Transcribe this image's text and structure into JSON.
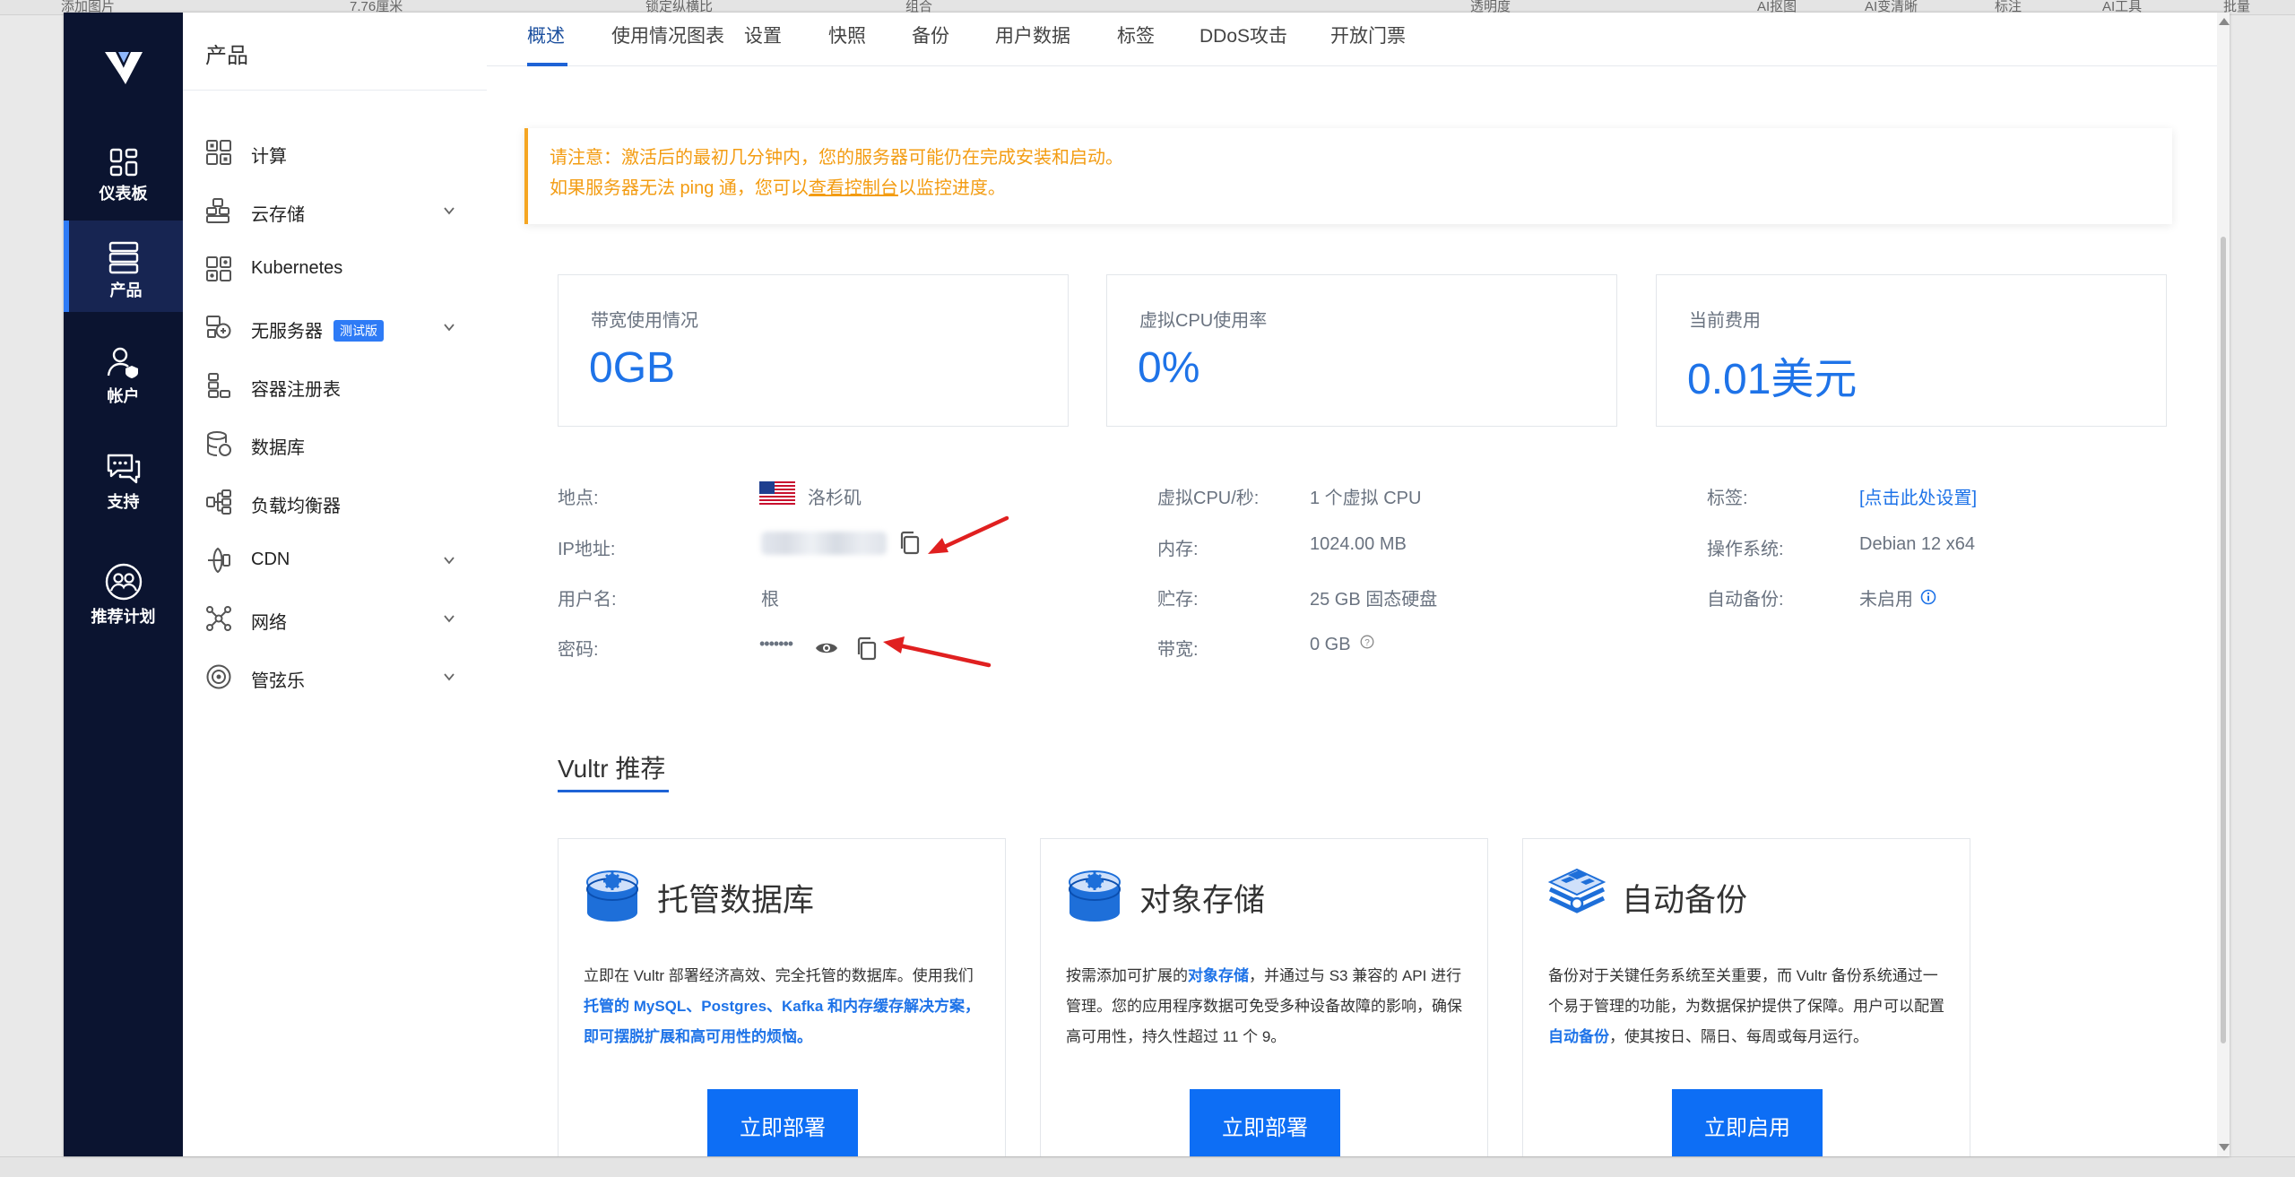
{
  "background_strip": [
    "添加图片",
    "7.76厘米",
    "锁定纵横比",
    "组合",
    "透明度",
    "AI抠图",
    "AI变清晰",
    "标注",
    "AI工具",
    "批量"
  ],
  "rail": {
    "items": [
      {
        "label": "仪表板",
        "icon": "dashboard-icon"
      },
      {
        "label": "产品",
        "icon": "server-stack-icon",
        "active": true
      },
      {
        "label": "帐户",
        "icon": "account-icon"
      },
      {
        "label": "支持",
        "icon": "chat-support-icon"
      },
      {
        "label": "推荐计划",
        "icon": "referral-icon"
      }
    ]
  },
  "menu": {
    "title": "产品",
    "items": [
      {
        "label": "计算",
        "icon": "compute-icon",
        "has_submenu": false
      },
      {
        "label": "云存储",
        "icon": "cloud-storage-icon",
        "has_submenu": true
      },
      {
        "label": "Kubernetes",
        "icon": "kubernetes-icon",
        "has_submenu": false
      },
      {
        "label": "无服务器",
        "icon": "serverless-icon",
        "has_submenu": true,
        "badge": "测试版"
      },
      {
        "label": "容器注册表",
        "icon": "container-registry-icon",
        "has_submenu": false
      },
      {
        "label": "数据库",
        "icon": "database-icon",
        "has_submenu": false
      },
      {
        "label": "负载均衡器",
        "icon": "load-balancer-icon",
        "has_submenu": false
      },
      {
        "label": "CDN",
        "icon": "cdn-icon",
        "has_submenu": true
      },
      {
        "label": "网络",
        "icon": "network-icon",
        "has_submenu": true
      },
      {
        "label": "管弦乐",
        "icon": "orchestration-icon",
        "has_submenu": true
      }
    ]
  },
  "tabs": [
    "概述",
    "使用情况图表",
    "设置",
    "快照",
    "备份",
    "用户数据",
    "标签",
    "DDoS攻击",
    "开放门票"
  ],
  "notice": {
    "line1": "请注意：激活后的最初几分钟内，您的服务器可能仍在完成安装和启动。",
    "line2_prefix": "如果服务器无法 ping 通，您可以",
    "line2_link": "查看控制台",
    "line2_suffix": "以监控进度。"
  },
  "stats": [
    {
      "label": "带宽使用情况",
      "value": "0GB"
    },
    {
      "label": "虚拟CPU使用率",
      "value": "0%"
    },
    {
      "label": "当前费用",
      "value": "0.01美元"
    }
  ],
  "details": {
    "location_label": "地点:",
    "location_value": "洛杉矶",
    "ip_label": "IP地址:",
    "user_label": "用户名:",
    "user_value": "根",
    "password_label": "密码:",
    "password_mask": "•••••••",
    "vcpu_label": "虚拟CPU/秒:",
    "vcpu_value": "1 个虚拟 CPU",
    "ram_label": "内存:",
    "ram_value": "1024.00 MB",
    "storage_label": "贮存:",
    "storage_value": "25 GB 固态硬盘",
    "bandwidth_label": "带宽:",
    "bandwidth_value": "0 GB",
    "tags_label": "标签:",
    "tags_value": "[点击此处设置]",
    "os_label": "操作系统:",
    "os_value": "Debian 12 x64",
    "backup_label": "自动备份:",
    "backup_value": "未启用"
  },
  "recommend": {
    "title": "Vultr 推荐",
    "cards": [
      {
        "title": "托管数据库",
        "desc_a": "立即在 Vultr 部署经济高效、完全托管的数据库。使用我们",
        "desc_b": "托管的 MySQL、Postgres、Kafka 和内存缓存解决方案，即可摆脱扩展和高可用性的烦恼。",
        "desc_c": "",
        "button": "立即部署"
      },
      {
        "title": "对象存储",
        "desc_a": "按需添加可扩展的",
        "desc_b": "对象存储",
        "desc_c": "，并通过与 S3 兼容的 API 进行管理。您的应用程序数据可免受多种设备故障的影响，确保高可用性，持久性超过 11 个 9。",
        "button": "立即部署"
      },
      {
        "title": "自动备份",
        "desc_a": "备份对于关键任务系统至关重要，而 Vultr 备份系统通过一个易于管理的功能，为数据保护提供了保障。用户可以配置",
        "desc_b": "自动备份",
        "desc_c": "，使其按日、隔日、每周或每月运行。",
        "button": "立即启用"
      }
    ]
  },
  "colors": {
    "rail_bg": "#0b1430",
    "accent": "#1e73e8",
    "warning": "#f39c12",
    "annotation_arrow": "#e02020"
  }
}
